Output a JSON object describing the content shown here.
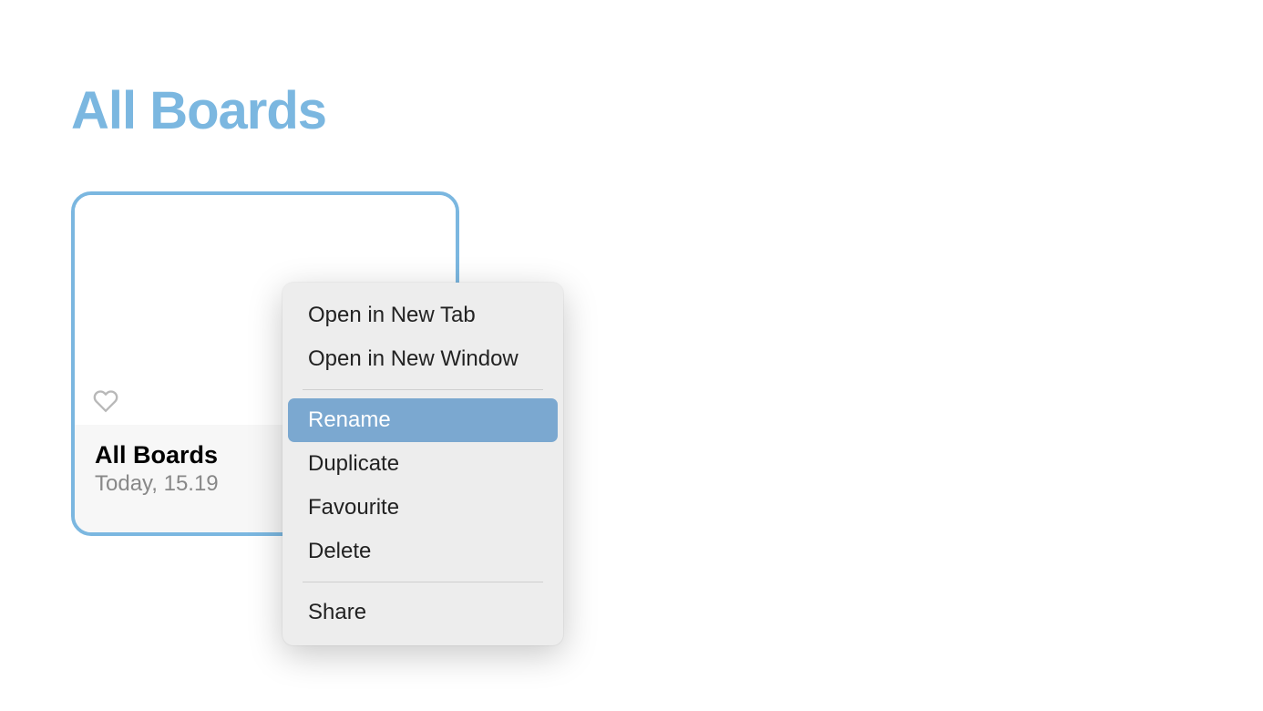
{
  "header": {
    "title": "All Boards"
  },
  "board": {
    "name": "All Boards",
    "timestamp": "Today, 15.19"
  },
  "contextMenu": {
    "group1": [
      {
        "label": "Open in New Tab"
      },
      {
        "label": "Open in New Window"
      }
    ],
    "group2": [
      {
        "label": "Rename",
        "highlighted": true
      },
      {
        "label": "Duplicate"
      },
      {
        "label": "Favourite"
      },
      {
        "label": "Delete"
      }
    ],
    "group3": [
      {
        "label": "Share"
      }
    ]
  }
}
